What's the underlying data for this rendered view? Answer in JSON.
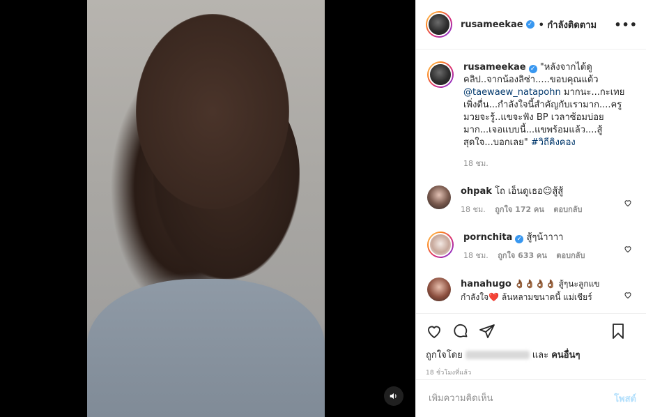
{
  "post": {
    "author": "rusameekae",
    "follow_label": "• กำลังติดตาม",
    "more_icon": "more-options-icon",
    "caption_prefix": "\"หลังจากได้ดูคลิป..จากน้องลิซ่า.....ขอบคุณแต้ว ",
    "caption_mention": "@taewaew_natapohn",
    "caption_suffix": " มากนะ...กะเทยเพิ่งตื่น...กำลังใจนี้สำคัญกับเรามาก....ครูมวยจะรู้..แขจะฟัง BP เวลาซ้อมบ่อยมาก...เจอแบบนี้...แขพร้อมแล้ว....สู้สุดใจ...บอกเลย\" ",
    "caption_hashtag": "#วิถีคิงคอง",
    "caption_time": "18 ชม."
  },
  "comments": [
    {
      "user": "ohpak",
      "verified": false,
      "text": "โถ เอ็นดูเธอ☺สู้สู้",
      "time": "18 ชม.",
      "likes": "ถูกใจ 172 คน",
      "reply": "ตอบกลับ"
    },
    {
      "user": "pornchita",
      "verified": true,
      "text": "สู้ๆน้าาาา",
      "time": "18 ชม.",
      "likes": "ถูกใจ 633 คน",
      "reply": "ตอบกลับ"
    },
    {
      "user": "hanahugo",
      "verified": false,
      "text": "👌🏾👌🏾👌🏾👌🏾 สู้ๆนะลูกแข กำลังใจ❤️ ล้นหลามขนาดนี้ แม่เชียร์",
      "time": "",
      "likes": "",
      "reply": ""
    }
  ],
  "likes_line": {
    "prefix": "ถูกใจโดย",
    "suffix": "และ",
    "others": "คนอื่นๆ"
  },
  "posted_ago": "18 ชั่วโมงที่แล้ว",
  "add_comment": {
    "placeholder": "เพิ่มความคิดเห็น",
    "post_label": "โพสต์"
  },
  "colors": {
    "link": "#00376b",
    "verified": "#3897f0",
    "post_button": "#b2dffc",
    "muted": "#8e8e8e"
  }
}
